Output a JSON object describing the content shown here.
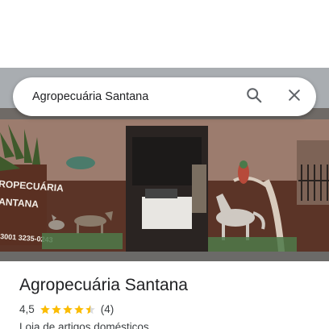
{
  "search": {
    "query": "Agropecuária Santana"
  },
  "icons": {
    "search": "search-icon",
    "close": "close-icon"
  },
  "photo": {
    "sign_line1": "ROPECUÁRIA",
    "sign_line2": "ANTANA",
    "sign_phone": "3001 3235-0243"
  },
  "place": {
    "name": "Agropecuária Santana",
    "rating": "4,5",
    "stars": 4.5,
    "review_count": "(4)",
    "category": "Loja de artigos domésticos"
  },
  "colors": {
    "star": "#fbbc04",
    "star_empty": "#dadce0",
    "text_primary": "#202124",
    "text_secondary": "#3c4043",
    "icon": "#5f6368"
  }
}
